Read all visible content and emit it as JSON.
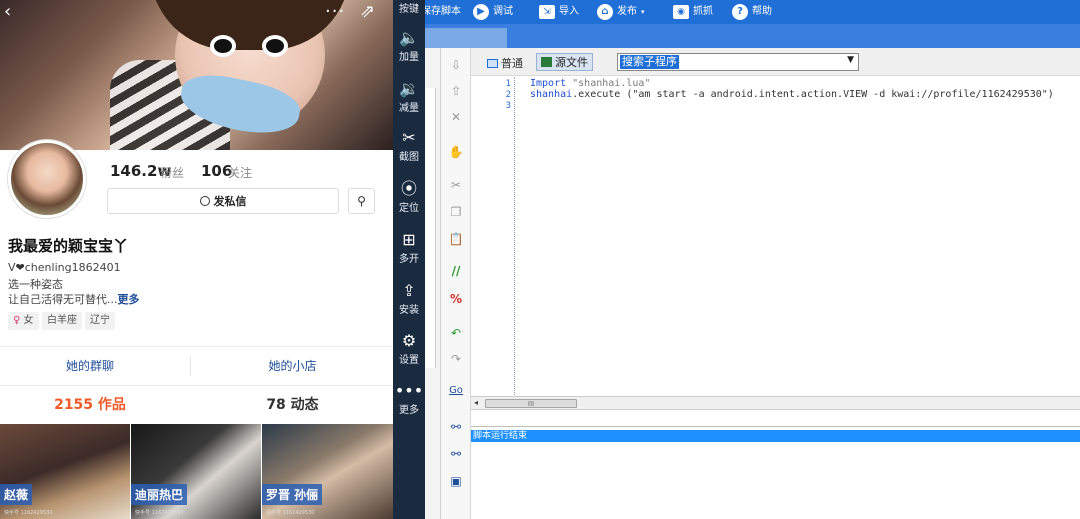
{
  "profile": {
    "top_icons": {
      "back": "‹",
      "more": "···",
      "share": "⇗"
    },
    "fans_count": "146.2w",
    "fans_label": "粉丝",
    "follow_count": "106",
    "follow_label": "关注",
    "message_button": "发私信",
    "nickname": "我最爱的颖宝宝丫",
    "wechat_prefix": "V",
    "wechat_id": "chenling1862401",
    "bio_line1": "选一种姿态",
    "bio_line2": "让自己活得无可替代...",
    "bio_more": "更多",
    "tags": {
      "gender": "女",
      "zodiac": "白羊座",
      "region": "辽宁"
    },
    "group_chat": "她的群聊",
    "shop": "她的小店",
    "works_tab": "2155 作品",
    "moments_tab": "78 动态",
    "thumbnails": [
      {
        "caption": "赵薇",
        "sub": "快手号 1162429530"
      },
      {
        "caption": "迪丽热巴",
        "sub": "快手号 1162429530"
      },
      {
        "caption": "罗晋 孙俪",
        "sub": "快手号 1162429530"
      }
    ]
  },
  "toolbar": {
    "items": [
      {
        "label": "按键",
        "icon": "keyboard-icon"
      },
      {
        "label": "加量",
        "icon": "volume-up-icon"
      },
      {
        "label": "减量",
        "icon": "volume-down-icon"
      },
      {
        "label": "截图",
        "icon": "scissors-icon"
      },
      {
        "label": "定位",
        "icon": "location-icon"
      },
      {
        "label": "多开",
        "icon": "multi-open-icon"
      },
      {
        "label": "安装",
        "icon": "install-apk-icon"
      },
      {
        "label": "设置",
        "icon": "gear-icon"
      },
      {
        "label": "更多",
        "icon": "more-dots-icon"
      }
    ]
  },
  "ide": {
    "menu": {
      "save_script": "保存脚本",
      "debug": "调试",
      "import": "导入",
      "publish": "发布",
      "capture": "抓抓",
      "help": "帮助"
    },
    "mode_normal": "普通",
    "mode_source": "源文件",
    "sub_select_value": "搜索子程序",
    "code_lines": [
      {
        "num": "1",
        "keyword": "Import",
        "rest": " \"shanhai.lua\""
      },
      {
        "num": "2",
        "keyword": "shanhai",
        "rest": ".execute (\"am start -a android.intent.action.VIEW -d kwai://profile/1162429530\")"
      },
      {
        "num": "3",
        "keyword": "",
        "rest": ""
      }
    ],
    "scroll_thumb": "III",
    "output_text": "脚本运行结束"
  },
  "colors": {
    "menubar": "#1f6fd6",
    "toolbar_bg": "#1b2b3f",
    "works_orange": "#f05a28",
    "link_blue": "#1f4e99",
    "output_highlight": "#1e90ff"
  }
}
